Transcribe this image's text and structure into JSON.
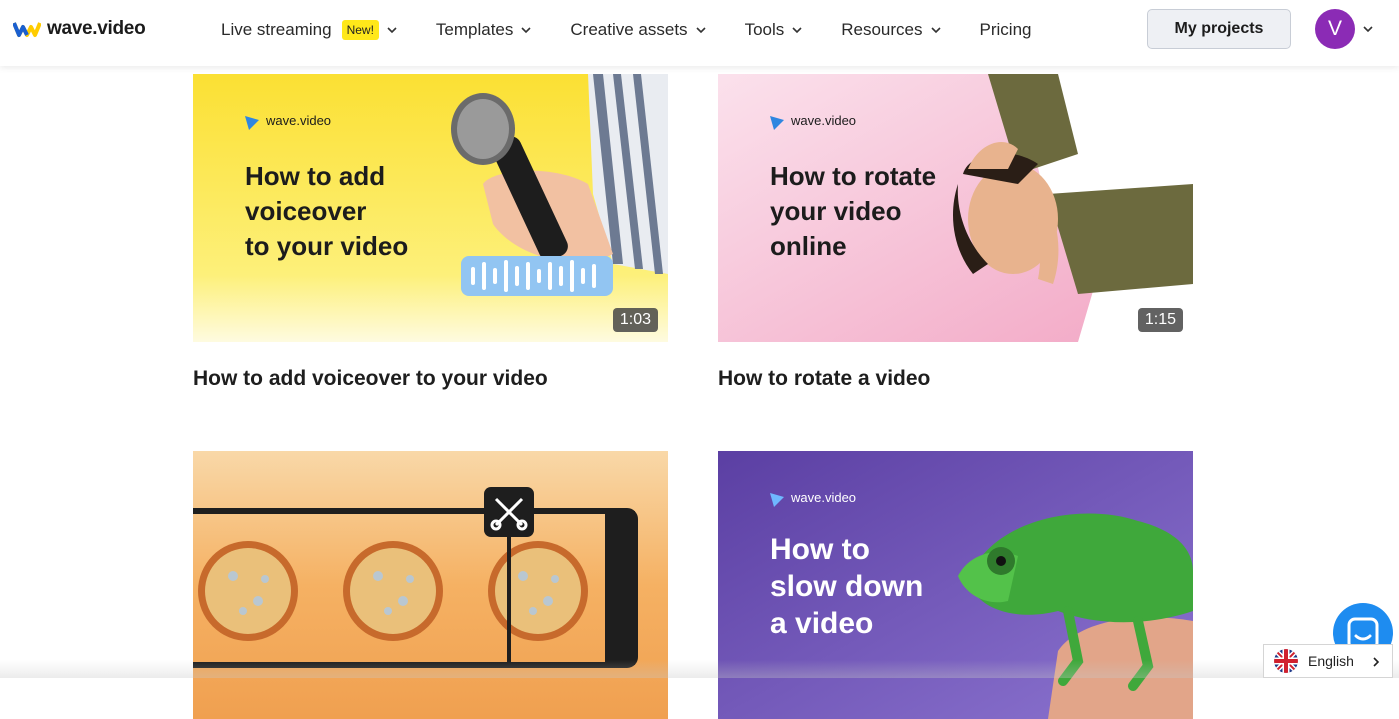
{
  "brand": {
    "logo_text": "wave.video",
    "accent": "#8b2bb5"
  },
  "nav": {
    "items": [
      {
        "label": "Live streaming",
        "badge": "New!",
        "has_dropdown": true
      },
      {
        "label": "Templates",
        "has_dropdown": true
      },
      {
        "label": "Creative assets",
        "has_dropdown": true
      },
      {
        "label": "Tools",
        "has_dropdown": true
      },
      {
        "label": "Resources",
        "has_dropdown": true
      },
      {
        "label": "Pricing",
        "has_dropdown": false
      }
    ],
    "my_projects_label": "My projects",
    "avatar_letter": "V"
  },
  "videos": [
    {
      "title": "How to add voiceover to your video",
      "duration": "1:03",
      "thumb_brand": "wave.video",
      "thumb_heading": [
        "How to add",
        "voiceover",
        "to your video"
      ],
      "bg": "#fbe24a"
    },
    {
      "title": "How to rotate a video",
      "duration": "1:15",
      "thumb_brand": "wave.video",
      "thumb_heading": [
        "How to rotate",
        "your video",
        "online"
      ],
      "bg": "#f5b6cf"
    },
    {
      "title": "",
      "duration": "",
      "thumb_brand": "",
      "thumb_heading": [],
      "bg": "#f4b36b"
    },
    {
      "title": "",
      "duration": "",
      "thumb_brand": "wave.video",
      "thumb_heading": [
        "How to",
        "slow down",
        "a video"
      ],
      "bg": "#6a4fb4"
    }
  ],
  "language": {
    "label": "English",
    "icon": "uk-flag-icon"
  },
  "chat": {
    "icon": "chat-icon",
    "color": "#1e8cf0"
  }
}
